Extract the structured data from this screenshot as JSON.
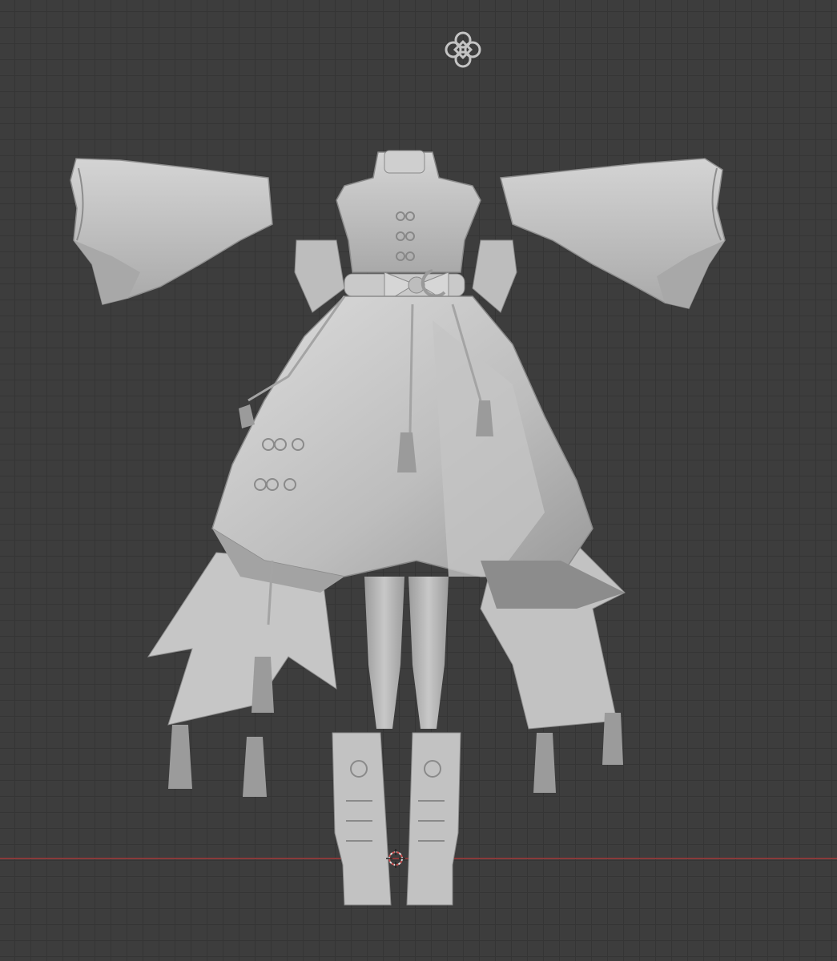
{
  "viewport": {
    "mode": "3d-viewport-solid-shading",
    "background_color": "#3d3d3d",
    "grid_color": "#353535",
    "x_axis_color": "#8a3a3a"
  },
  "model": {
    "subject": "dress-outfit-mesh",
    "base_color": "#b8b8b8",
    "highlight_color": "#dcdcdc",
    "shadow_color": "#7a7a7a"
  },
  "icons": {
    "floating_ornament": "flower-knot-ornament-icon",
    "origin": "3d-cursor-icon"
  }
}
